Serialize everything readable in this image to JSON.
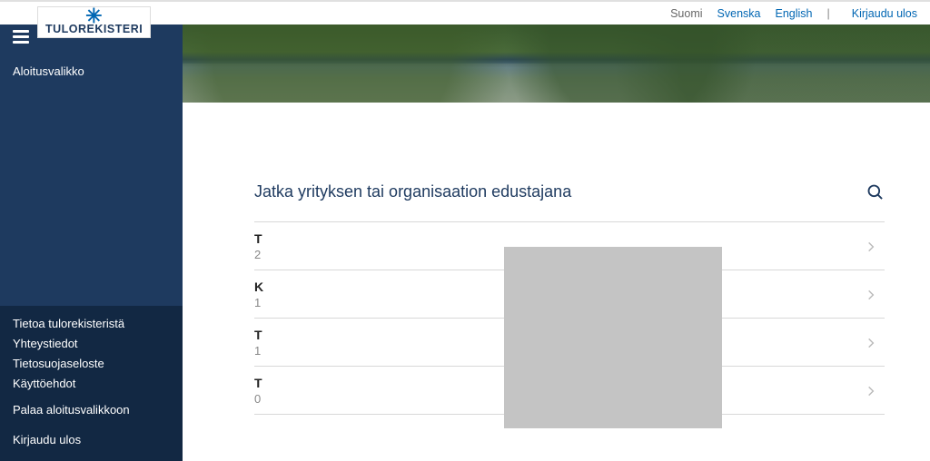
{
  "top_bar": {
    "languages": [
      {
        "label": "Suomi",
        "active": false
      },
      {
        "label": "Svenska",
        "active": true
      },
      {
        "label": "English",
        "active": true
      }
    ],
    "logout": "Kirjaudu ulos"
  },
  "logo": {
    "text": "TULOREKISTERI"
  },
  "sidebar": {
    "top_link": "Aloitusvalikko",
    "links1": [
      "Tietoa tulorekisteristä",
      "Yhteystiedot",
      "Tietosuojaseloste",
      "Käyttöehdot"
    ],
    "link_return": "Palaa aloitusvalikkoon",
    "link_logout": "Kirjaudu ulos"
  },
  "main": {
    "heading": "Jatka yrityksen tai organisaation edustajana",
    "rows": [
      {
        "title": "T",
        "sub": "2"
      },
      {
        "title": "K",
        "sub": "1"
      },
      {
        "title": "T",
        "sub": "1"
      },
      {
        "title": "T",
        "sub": "0"
      }
    ]
  }
}
